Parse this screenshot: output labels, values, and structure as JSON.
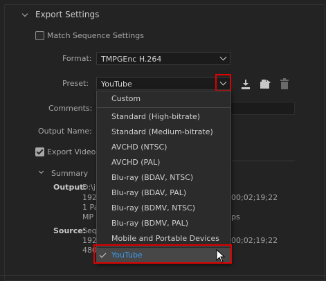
{
  "export_settings": {
    "title": "Export Settings",
    "match_sequence_label": "Match Sequence Settings",
    "format_label": "Format:",
    "format_value": "TMPGEnc H.264",
    "preset_label": "Preset:",
    "preset_value": "YouTube",
    "comments_label": "Comments:",
    "output_name_label": "Output Name:",
    "export_video_label": "Export Video"
  },
  "summary": {
    "title": "Summary",
    "output_label": "Output:",
    "output_lines": [
      "D:\\j",
      "192",
      "1 Pa",
      "MP"
    ],
    "output_right": [
      "00;02;19;22",
      "ps"
    ],
    "source_label": "Source:",
    "source_lines": [
      "Seq",
      "192",
      "480"
    ],
    "source_right": [
      "00;02;19;22"
    ]
  },
  "preset_menu": {
    "items": [
      {
        "label": "Custom"
      },
      {
        "label": "Standard (High-bitrate)"
      },
      {
        "label": "Standard (Medium-bitrate)"
      },
      {
        "label": "AVCHD (NTSC)"
      },
      {
        "label": "AVCHD (PAL)"
      },
      {
        "label": "Blu-ray (BDAV, NTSC)"
      },
      {
        "label": "Blu-ray (BDAV, PAL)"
      },
      {
        "label": "Blu-ray (BDMV, NTSC)"
      },
      {
        "label": "Blu-ray (BDMV, PAL)"
      },
      {
        "label": "Mobile and Portable Devices"
      },
      {
        "label": "YouTube"
      }
    ]
  },
  "colors": {
    "highlight_border": "#e00000",
    "selected_text": "#3a9bf0"
  }
}
